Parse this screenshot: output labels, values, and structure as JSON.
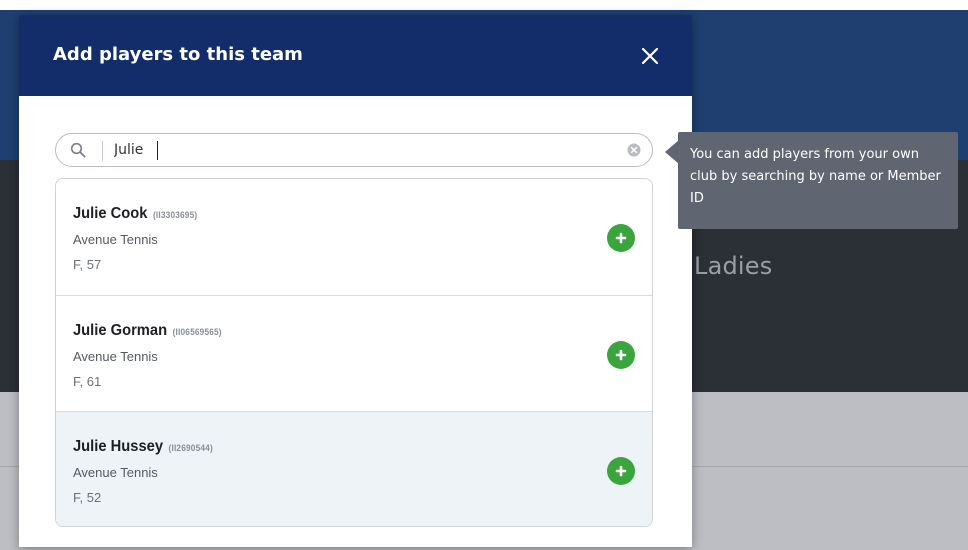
{
  "background": {
    "section_title_partial": "Ladies"
  },
  "modal": {
    "title": "Add players to this team",
    "close_icon": "close-icon"
  },
  "search": {
    "value": "Julie",
    "placeholder": "",
    "search_icon": "search-icon",
    "clear_icon": "clear-icon"
  },
  "results": [
    {
      "name": "Julie Cook",
      "member_id": "(II3303695)",
      "club": "Avenue Tennis",
      "info": "F, 57"
    },
    {
      "name": "Julie Gorman",
      "member_id": "(II06569565)",
      "club": "Avenue Tennis",
      "info": "F, 61"
    },
    {
      "name": "Julie Hussey",
      "member_id": "(II2690544)",
      "club": "Avenue Tennis",
      "info": "F, 52"
    }
  ],
  "tooltip": {
    "text": "You can add players from your own club by searching by name or Member ID"
  },
  "colors": {
    "header": "#132d6b",
    "add_button": "#3aa53c",
    "tooltip_bg": "#5f6571",
    "hover_row": "#eef3f8"
  }
}
